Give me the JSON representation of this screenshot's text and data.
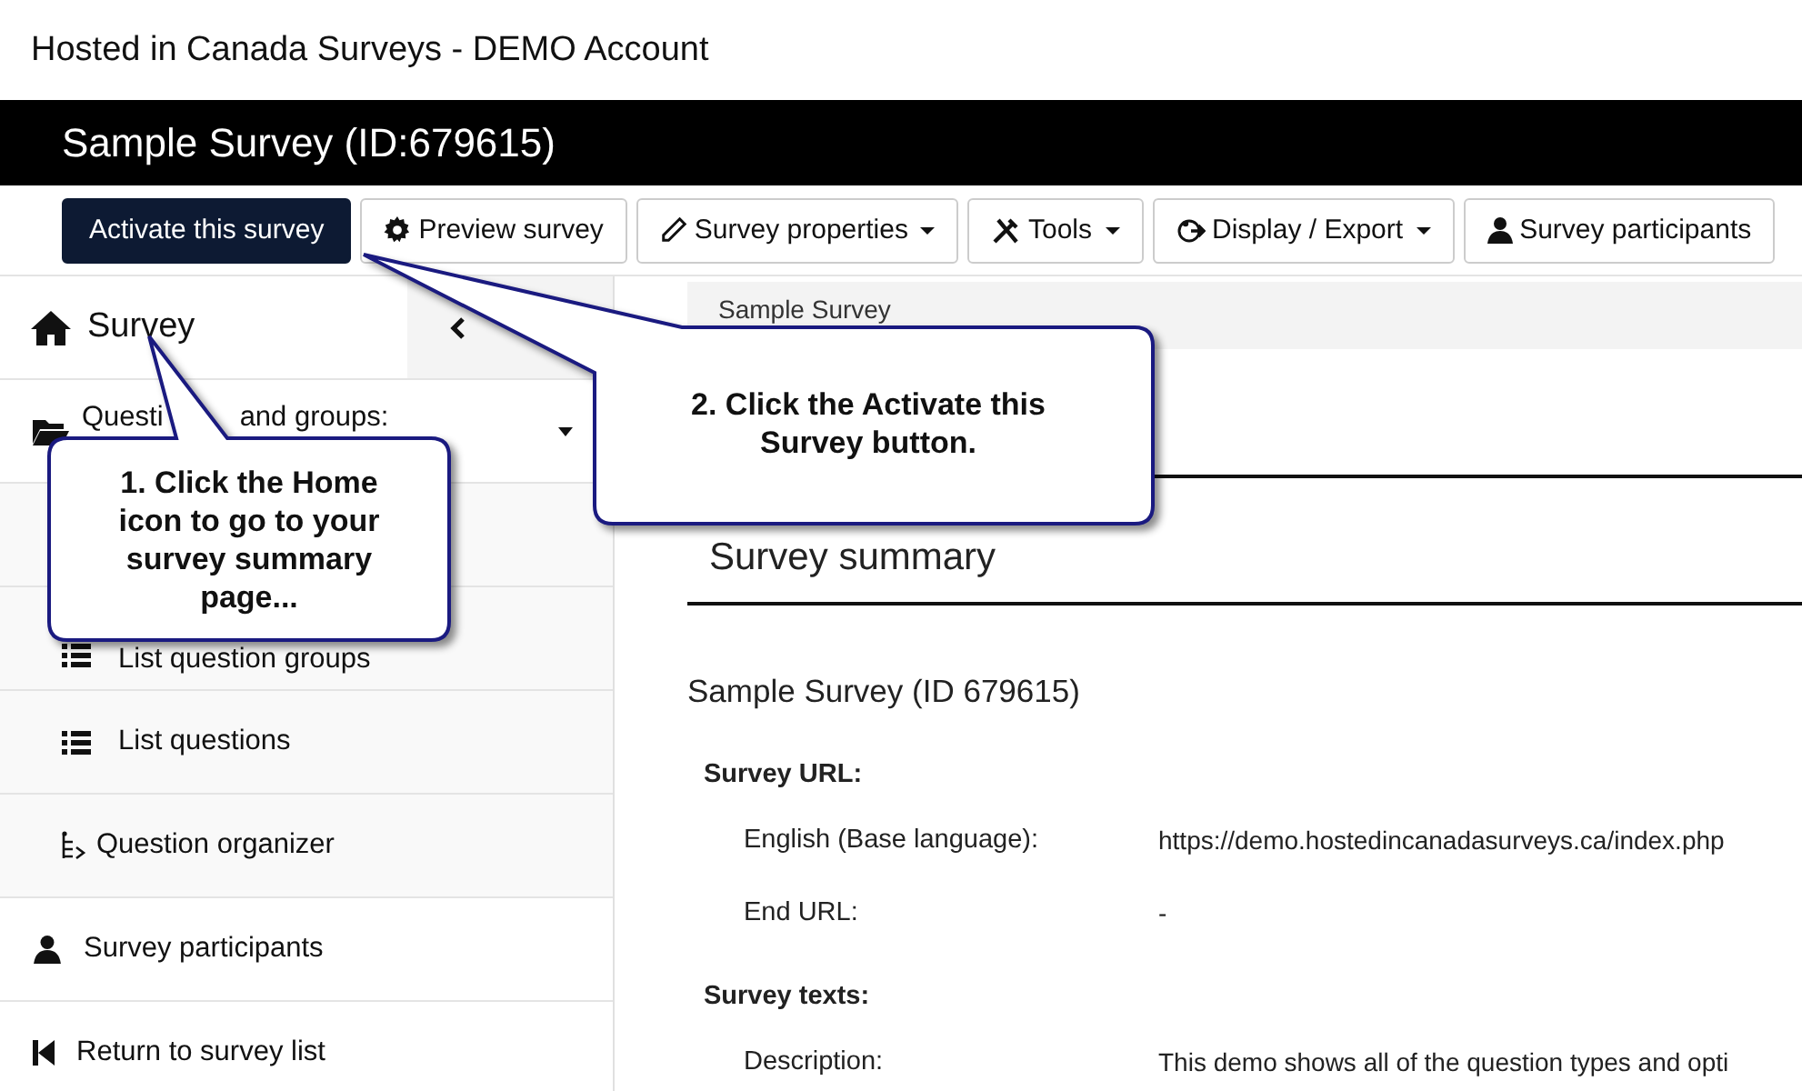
{
  "site_title": "Hosted in Canada Surveys - DEMO Account",
  "survey_bar": {
    "title": "Sample Survey (ID:679615)"
  },
  "toolbar": [
    {
      "label": "Activate this survey",
      "kind": "primary",
      "has_menu": false
    },
    {
      "label": "Preview survey",
      "kind": "default",
      "has_menu": false
    },
    {
      "label": "Survey properties",
      "kind": "default",
      "has_menu": true
    },
    {
      "label": "Tools",
      "kind": "default",
      "has_menu": true
    },
    {
      "label": "Display / Export",
      "kind": "default",
      "has_menu": true
    },
    {
      "label": "Survey participants",
      "kind": "default",
      "has_menu": false
    }
  ],
  "sidebar": {
    "home": {
      "label": "Survey"
    },
    "items": [
      {
        "label_parts": [
          "Questi",
          "and groups:"
        ],
        "expanded": true,
        "children": [
          {
            "label": "List question groups"
          },
          {
            "label": "List questions"
          },
          {
            "label": "Question organizer"
          }
        ]
      },
      {
        "label": "Survey participants"
      },
      {
        "label": "Return to survey list"
      }
    ]
  },
  "breadcrumb": "Sample Survey",
  "summary": {
    "heading": "Survey summary",
    "survey_name": "Sample Survey (ID 679615)",
    "sections": [
      {
        "heading": "Survey URL:",
        "rows": [
          {
            "label": "English (Base language):",
            "value": "https://demo.hostedincanadasurveys.ca/index.php"
          },
          {
            "label": "End URL:",
            "value": "-"
          }
        ]
      },
      {
        "heading": "Survey texts:",
        "rows": [
          {
            "label": "Description:",
            "value": "This demo shows all of the question types and opti"
          }
        ]
      }
    ]
  },
  "callouts": [
    {
      "text": "1. Click the Home icon to go to your survey summary page..."
    },
    {
      "text": "2. Click the Activate this Survey button."
    }
  ]
}
